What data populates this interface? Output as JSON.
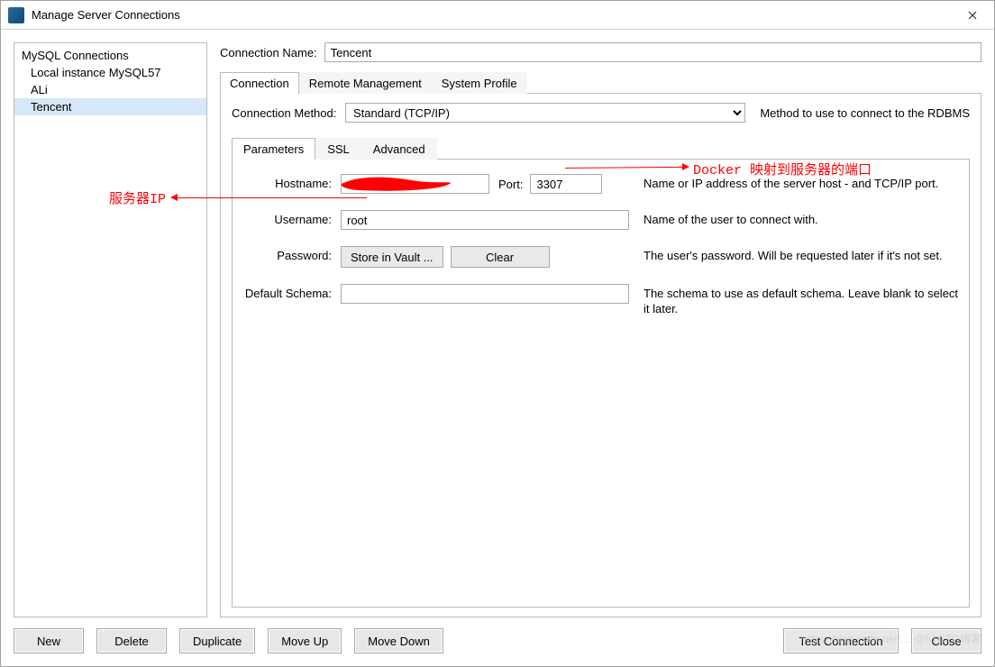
{
  "window": {
    "title": "Manage Server Connections"
  },
  "sidebar": {
    "header": "MySQL Connections",
    "items": [
      "Local instance MySQL57",
      "ALi",
      "Tencent"
    ],
    "selected_index": 2
  },
  "form": {
    "connection_name_label": "Connection Name:",
    "connection_name_value": "Tencent",
    "tabs": [
      "Connection",
      "Remote Management",
      "System Profile"
    ],
    "method_label": "Connection Method:",
    "method_value": "Standard (TCP/IP)",
    "method_desc": "Method to use to connect to the RDBMS",
    "inner_tabs": [
      "Parameters",
      "SSL",
      "Advanced"
    ],
    "params": {
      "hostname_label": "Hostname:",
      "hostname_value": "",
      "port_label": "Port:",
      "port_value": "3307",
      "host_desc": "Name or IP address of the server host - and TCP/IP port.",
      "username_label": "Username:",
      "username_value": "root",
      "username_desc": "Name of the user to connect with.",
      "password_label": "Password:",
      "store_button": "Store in Vault ...",
      "clear_button": "Clear",
      "password_desc": "The user's password. Will be requested later if it's not set.",
      "schema_label": "Default Schema:",
      "schema_value": "",
      "schema_desc": "The schema to use as default schema. Leave blank to select it later."
    }
  },
  "footer": {
    "new": "New",
    "delete": "Delete",
    "duplicate": "Duplicate",
    "moveup": "Move Up",
    "movedown": "Move Down",
    "test": "Test Connection",
    "close": "Close"
  },
  "annotations": {
    "left": "服务器IP",
    "right": "Docker 映射到服务器的端口"
  },
  "watermark": "https://blog.csdn.net/…  @51CTO博客"
}
